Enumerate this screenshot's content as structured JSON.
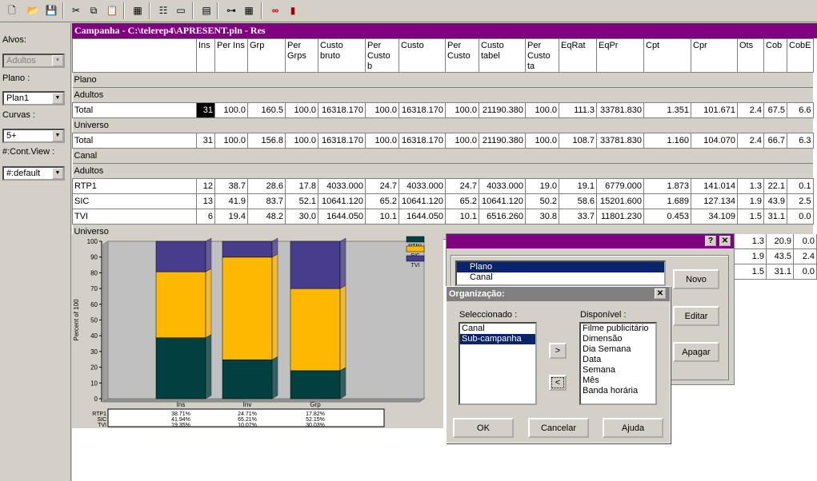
{
  "toolbar": {
    "icons": [
      "new-icon",
      "open-icon",
      "save-icon",
      "cut-icon",
      "copy-icon",
      "paste-icon",
      "calculator-icon",
      "properties-icon",
      "window-icon",
      "grid-icon",
      "tree-icon",
      "table-icon",
      "link-icon",
      "book-icon"
    ]
  },
  "left_panel": {
    "alvos_label": "Alvos:",
    "alvos_value": "Adultos",
    "plano_label": "Plano :",
    "plano_value": "Plan1",
    "curvas_label": "Curvas :",
    "curvas_value": "5+",
    "contview_label": "#:Cont.View :",
    "contview_value": "#:default"
  },
  "document": {
    "title": "Campanha - C:\\telerep4\\APRESENT.pln - Res",
    "columns": [
      "Ins",
      "Per Ins",
      "Grp",
      "Per Grps",
      "Custo bruto",
      "Per Custo b",
      "Custo",
      "Per Custo",
      "Custo tabel",
      "Per Custo ta",
      "EqRat",
      "EqPr",
      "Cpt",
      "Cpr",
      "Ots",
      "Cob",
      "CobE"
    ],
    "rows": [
      {
        "type": "section",
        "label": "Plano"
      },
      {
        "type": "section",
        "label": "Adultos"
      },
      {
        "type": "data",
        "label": "Total",
        "values": [
          "31",
          "100.0",
          "160.5",
          "100.0",
          "16318.170",
          "100.0",
          "16318.170",
          "100.0",
          "21190.380",
          "100.0",
          "111.3",
          "33781.830",
          "1.351",
          "101.671",
          "2.4",
          "67.5",
          "6.6"
        ],
        "selected_first": true
      },
      {
        "type": "section",
        "label": "Universo"
      },
      {
        "type": "data",
        "label": "Total",
        "values": [
          "31",
          "100.0",
          "156.8",
          "100.0",
          "16318.170",
          "100.0",
          "16318.170",
          "100.0",
          "21190.380",
          "100.0",
          "108.7",
          "33781.830",
          "1.160",
          "104.070",
          "2.4",
          "66.7",
          "6.3"
        ]
      },
      {
        "type": "section",
        "label": "Canal"
      },
      {
        "type": "section",
        "label": "Adultos"
      },
      {
        "type": "data",
        "label": "RTP1",
        "values": [
          "12",
          "38.7",
          "28.6",
          "17.8",
          "4033.000",
          "24.7",
          "4033.000",
          "24.7",
          "4033.000",
          "19.0",
          "19.1",
          "6779.000",
          "1.873",
          "141.014",
          "1.3",
          "22.1",
          "0.1"
        ]
      },
      {
        "type": "data",
        "label": "SIC",
        "values": [
          "13",
          "41.9",
          "83.7",
          "52.1",
          "10641.120",
          "65.2",
          "10641.120",
          "65.2",
          "10641.120",
          "50.2",
          "58.6",
          "15201.600",
          "1.689",
          "127.134",
          "1.9",
          "43.9",
          "2.5"
        ]
      },
      {
        "type": "data",
        "label": "TVI",
        "values": [
          "6",
          "19.4",
          "48.2",
          "30.0",
          "1644.050",
          "10.1",
          "1644.050",
          "10.1",
          "6516.260",
          "30.8",
          "33.7",
          "11801.230",
          "0.453",
          "34.109",
          "1.5",
          "31.1",
          "0.0"
        ]
      },
      {
        "type": "section",
        "label": "Universo"
      }
    ],
    "hidden_rows_right": [
      {
        "ots": "1.3",
        "cob": "20.9",
        "cobe": "0.0"
      },
      {
        "ots": "1.9",
        "cob": "43.5",
        "cobe": "2.4"
      },
      {
        "ots": "1.5",
        "cob": "31.1",
        "cobe": "0.0"
      }
    ]
  },
  "chart_data": {
    "type": "bar",
    "stacked": true,
    "percent": true,
    "categories": [
      "Ins",
      "Inv",
      "Grp"
    ],
    "series": [
      {
        "name": "RTP1",
        "values": [
          38.71,
          24.71,
          17.82
        ],
        "color": "#004040"
      },
      {
        "name": "SIC",
        "values": [
          41.94,
          65.21,
          52.15
        ],
        "color": "#ffb800"
      },
      {
        "name": "TVI",
        "values": [
          19.35,
          10.07,
          30.03
        ],
        "color": "#483c8c"
      }
    ],
    "ylabel": "Percent of 100",
    "ylim": [
      0,
      100
    ],
    "yticks": [
      "0",
      "10",
      "20",
      "30",
      "40",
      "50",
      "60",
      "70",
      "80",
      "90",
      "100"
    ],
    "table_labels": [
      [
        "38.71%",
        "24.71%",
        "17.82%"
      ],
      [
        "41.94%",
        "65.21%",
        "52.15%"
      ],
      [
        "19.35%",
        "10.07%",
        "30.03%"
      ]
    ],
    "legend_position": "top-right"
  },
  "dialog_back": {
    "help_btn": "?",
    "close_btn": "✕",
    "list": [
      "Plano",
      "Canal"
    ],
    "selected_index": 0,
    "btn_novo": "Novo",
    "btn_editar": "Editar",
    "btn_apagar": "Apagar"
  },
  "dialog_front": {
    "title": "Organização:",
    "close_btn": "✕",
    "seleccionado_label": "Seleccionado :",
    "seleccionado": [
      "Canal",
      "Sub-campanha"
    ],
    "seleccionado_selected": 1,
    "disponivel_label": "Disponível :",
    "disponivel": [
      "Filme publicitário",
      "Dimensão",
      "Dia Semana",
      "Data",
      "Semana",
      "Mês",
      "Banda horária"
    ],
    "move_right": ">",
    "move_left": "<",
    "btn_ok": "OK",
    "btn_cancelar": "Cancelar",
    "btn_ajuda": "Ajuda"
  }
}
